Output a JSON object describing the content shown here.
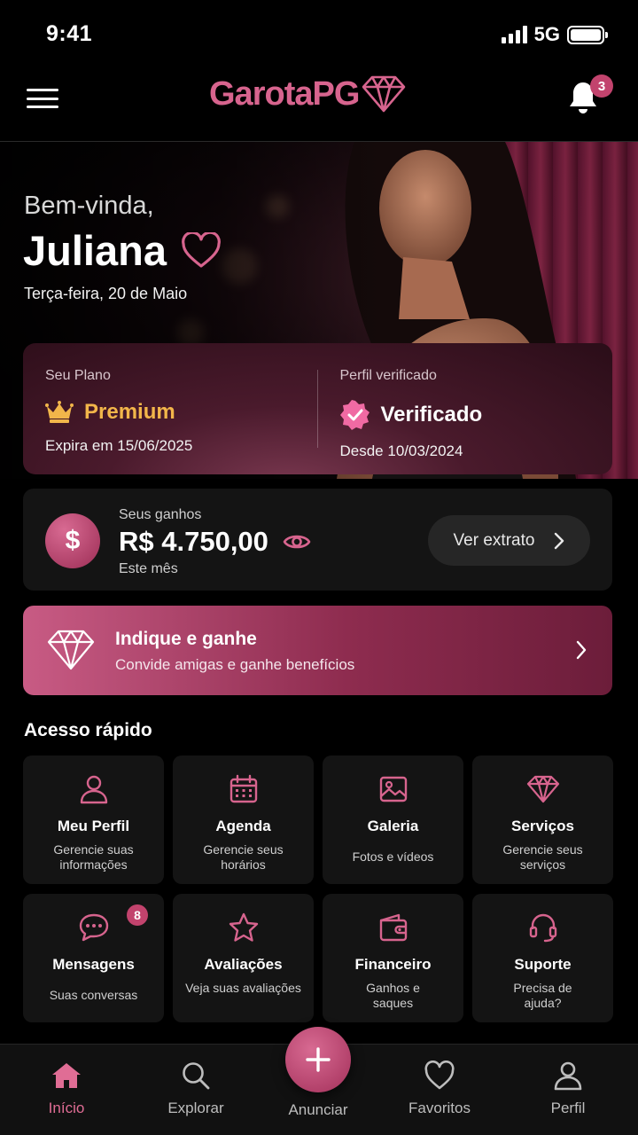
{
  "status_bar": {
    "time": "9:41",
    "network": "5G"
  },
  "header": {
    "logo": "GarotaPG",
    "notification_count": "3"
  },
  "hero": {
    "greeting": "Bem-vinda,",
    "name": "Juliana",
    "date": "Terça-feira, 20 de Maio"
  },
  "plan": {
    "plan_label": "Seu Plano",
    "plan_value": "Premium",
    "plan_expiry": "Expira em 15/06/2025",
    "verified_label": "Perfil verificado",
    "verified_value": "Verificado",
    "verified_since": "Desde 10/03/2024"
  },
  "earnings": {
    "label": "Seus ganhos",
    "value": "R$ 4.750,00",
    "period": "Este mês",
    "button": "Ver extrato"
  },
  "referral": {
    "title": "Indique e ganhe",
    "subtitle": "Convide amigas e ganhe benefícios"
  },
  "quick_access": {
    "title": "Acesso rápido",
    "tiles": [
      {
        "title": "Meu Perfil",
        "subtitle": "Gerencie suas informações",
        "icon": "user-icon"
      },
      {
        "title": "Agenda",
        "subtitle": "Gerencie seus horários",
        "icon": "calendar-icon"
      },
      {
        "title": "Galeria",
        "subtitle": "Fotos e vídeos",
        "icon": "image-icon"
      },
      {
        "title": "Serviços",
        "subtitle": "Gerencie seus serviços",
        "icon": "diamond-icon"
      },
      {
        "title": "Mensagens",
        "subtitle": "Suas conversas",
        "icon": "chat-icon",
        "badge": "8"
      },
      {
        "title": "Avaliações",
        "subtitle": "Veja suas avaliações",
        "icon": "star-icon"
      },
      {
        "title": "Financeiro",
        "subtitle": "Ganhos e saques",
        "icon": "wallet-icon"
      },
      {
        "title": "Suporte",
        "subtitle": "Precisa de ajuda?",
        "icon": "headset-icon"
      }
    ]
  },
  "bottom_nav": {
    "items": [
      {
        "label": "Início",
        "icon": "home-icon",
        "active": true
      },
      {
        "label": "Explorar",
        "icon": "search-icon"
      },
      {
        "label": "Anunciar",
        "icon": "plus-icon"
      },
      {
        "label": "Favoritos",
        "icon": "heart-icon"
      },
      {
        "label": "Perfil",
        "icon": "user-icon"
      }
    ]
  },
  "colors": {
    "accent": "#d7648e",
    "gold": "#f2b64a",
    "card": "#141414",
    "background": "#000000"
  }
}
